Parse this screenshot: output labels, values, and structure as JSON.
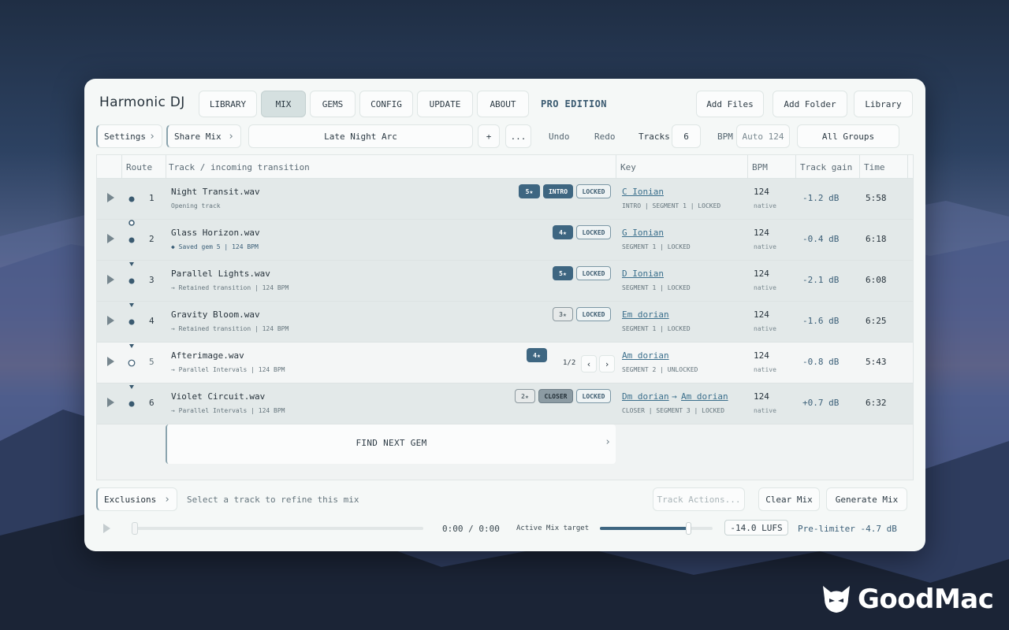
{
  "app": {
    "title": "Harmonic DJ",
    "edition": "PRO EDITION"
  },
  "nav": {
    "tabs": [
      "LIBRARY",
      "MIX",
      "GEMS",
      "CONFIG",
      "UPDATE",
      "ABOUT"
    ],
    "active": "MIX"
  },
  "top_actions": {
    "add_files": "Add Files",
    "add_folder": "Add Folder",
    "library": "Library"
  },
  "toolbar": {
    "settings": "Settings",
    "share_mix": "Share Mix",
    "mix_name": "Late Night Arc",
    "plus": "+",
    "more": "...",
    "undo": "Undo",
    "redo": "Redo",
    "tracks_label": "Tracks",
    "tracks_value": "6",
    "bpm_label": "BPM",
    "bpm_value": "Auto 124",
    "groups": "All Groups"
  },
  "table": {
    "headers": {
      "route": "Route",
      "track": "Track / incoming transition",
      "key": "Key",
      "bpm": "BPM",
      "gain": "Track gain",
      "time": "Time"
    },
    "rows": [
      {
        "num": "1",
        "name": "Night Transit.wav",
        "sub": "Opening track",
        "badges": [
          "5★",
          "INTRO",
          "LOCKED"
        ],
        "key": "C Ionian",
        "key_sub": "INTRO | SEGMENT 1 | LOCKED",
        "bpm": "124",
        "bpm_sub": "native",
        "gain": "-1.2 dB",
        "time": "5:58"
      },
      {
        "num": "2",
        "name": "Glass Horizon.wav",
        "sub": "◆  Saved gem 5 | 124 BPM",
        "badges": [
          "4★",
          "LOCKED"
        ],
        "key": "G Ionian",
        "key_sub": "SEGMENT 1 | LOCKED",
        "bpm": "124",
        "bpm_sub": "native",
        "gain": "-0.4 dB",
        "time": "6:18"
      },
      {
        "num": "3",
        "name": "Parallel Lights.wav",
        "sub": "→  Retained transition | 124 BPM",
        "badges": [
          "5★",
          "LOCKED"
        ],
        "key": "D Ionian",
        "key_sub": "SEGMENT 1 | LOCKED",
        "bpm": "124",
        "bpm_sub": "native",
        "gain": "-2.1 dB",
        "time": "6:08"
      },
      {
        "num": "4",
        "name": "Gravity Bloom.wav",
        "sub": "→  Retained transition | 124 BPM",
        "badges": [
          "3★",
          "LOCKED"
        ],
        "key": "Em dorian",
        "key_sub": "SEGMENT 1 | LOCKED",
        "bpm": "124",
        "bpm_sub": "native",
        "gain": "-1.6 dB",
        "time": "6:25"
      },
      {
        "num": "5",
        "name": "Afterimage.wav",
        "sub": "→  Parallel Intervals | 124 BPM",
        "badges": [
          "4★"
        ],
        "pager": "1/2",
        "key": "Am dorian",
        "key_sub": "SEGMENT 2 | UNLOCKED",
        "bpm": "124",
        "bpm_sub": "native",
        "gain": "-0.8 dB",
        "time": "5:43"
      },
      {
        "num": "6",
        "name": "Violet Circuit.wav",
        "sub": "→  Parallel Intervals | 124 BPM",
        "badges": [
          "2★",
          "CLOSER",
          "LOCKED"
        ],
        "key": "Dm dorian",
        "key2": "Am dorian",
        "key_arrow": "→",
        "key_sub": "CLOSER | SEGMENT 3 | LOCKED",
        "bpm": "124",
        "bpm_sub": "native",
        "gain": "+0.7 dB",
        "time": "6:32"
      }
    ],
    "find_next": "FIND NEXT GEM"
  },
  "bottom": {
    "exclusions": "Exclusions",
    "hint": "Select a track to refine this mix",
    "track_actions": "Track Actions...",
    "clear_mix": "Clear Mix",
    "generate_mix": "Generate Mix",
    "timecode": "0:00 / 0:00",
    "target_label": "Active Mix target",
    "target_level": 0.78,
    "lufs": "-14.0 LUFS",
    "prelimiter": "Pre-limiter -4.7 dB"
  },
  "watermark": {
    "text": "GoodMac"
  },
  "colors": {
    "accent": "#3e6681",
    "window": "#f5f8f7",
    "gain": "#3b5f78"
  }
}
